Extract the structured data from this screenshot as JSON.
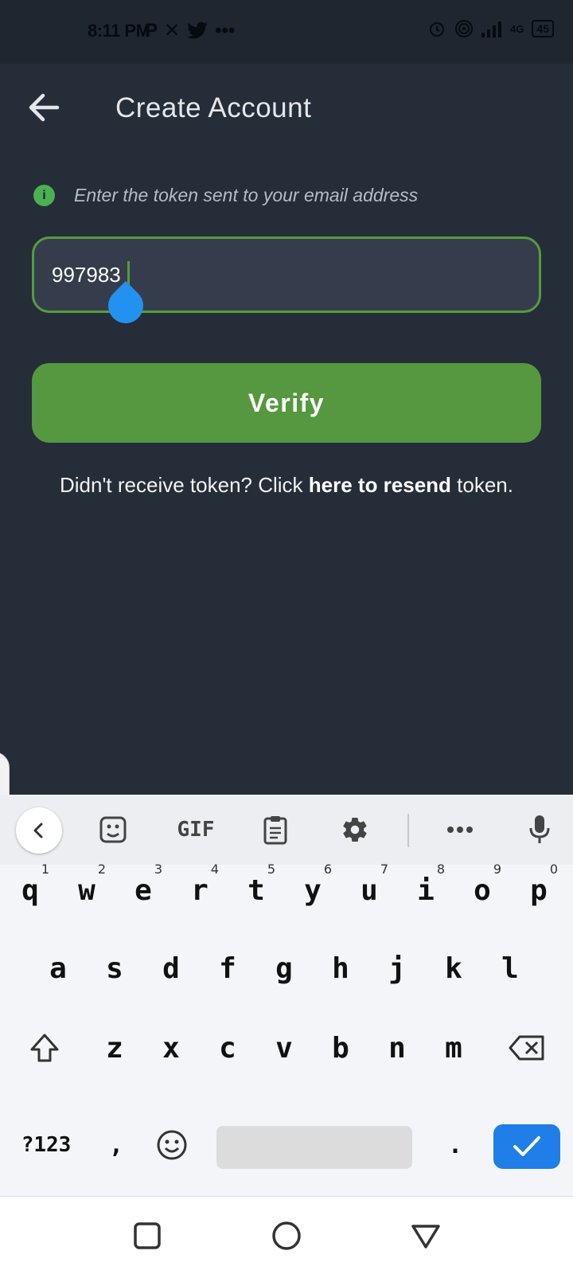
{
  "status_bar": {
    "time": "8:11 PM",
    "left_icons": [
      "P",
      "✕",
      "twitter-bird",
      "•••"
    ],
    "network_label": "4G",
    "battery": "45"
  },
  "header": {
    "title": "Create Account",
    "back_icon": "arrow-left-icon"
  },
  "info": {
    "icon": "info-icon",
    "icon_glyph": "i",
    "text": "Enter the token sent to your email address"
  },
  "token_input": {
    "value": "997983",
    "accent": "#579b3d"
  },
  "verify_button": {
    "label": "Verify",
    "color": "#55983f"
  },
  "resend": {
    "prefix": "Didn't receive token? Click ",
    "link": "here to resend",
    "suffix": " token."
  },
  "keyboard": {
    "toolbar": {
      "gif_label": "GIF",
      "icons": [
        "chevron-left-icon",
        "sticker-icon",
        "gif-icon",
        "clipboard-icon",
        "gear-icon",
        "more-icon",
        "mic-icon"
      ]
    },
    "row1": [
      {
        "key": "q",
        "hint": "1"
      },
      {
        "key": "w",
        "hint": "2"
      },
      {
        "key": "e",
        "hint": "3"
      },
      {
        "key": "r",
        "hint": "4"
      },
      {
        "key": "t",
        "hint": "5"
      },
      {
        "key": "y",
        "hint": "6"
      },
      {
        "key": "u",
        "hint": "7"
      },
      {
        "key": "i",
        "hint": "8"
      },
      {
        "key": "o",
        "hint": "9"
      },
      {
        "key": "p",
        "hint": "0"
      }
    ],
    "row2": [
      "a",
      "s",
      "d",
      "f",
      "g",
      "h",
      "j",
      "k",
      "l"
    ],
    "row3": [
      "z",
      "x",
      "c",
      "v",
      "b",
      "n",
      "m"
    ],
    "row4": {
      "symbols": "?123",
      "comma": ",",
      "period": "."
    },
    "accent": "#1f7ee8"
  },
  "nav_bar": {
    "buttons": [
      "recents-square-icon",
      "home-circle-icon",
      "back-triangle-icon"
    ]
  }
}
